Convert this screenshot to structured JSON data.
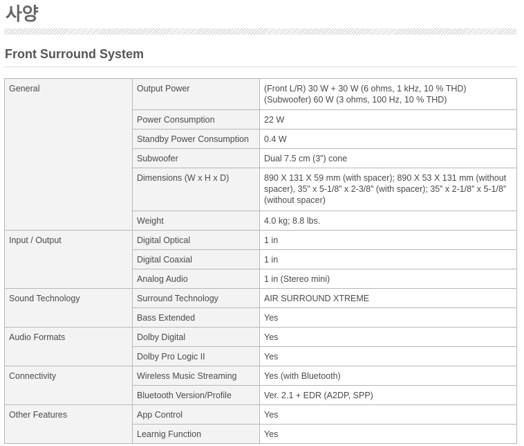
{
  "page": {
    "title": "사양",
    "section_title": "Front Surround System"
  },
  "groups": [
    {
      "name": "General",
      "rows": [
        {
          "label": "Output Power",
          "value": [
            "(Front L/R) 30 W + 30 W (6 ohms, 1 kHz, 10 % THD)",
            "(Subwoofer) 60 W (3 ohms, 100 Hz, 10 % THD)"
          ]
        },
        {
          "label": "Power Consumption",
          "value": [
            "22 W"
          ]
        },
        {
          "label": "Standby Power Consumption",
          "value": [
            "0.4 W"
          ]
        },
        {
          "label": "Subwoofer",
          "value": [
            "Dual 7.5 cm (3”) cone"
          ]
        },
        {
          "label": "Dimensions (W x H x D)",
          "value": [
            "890 X 131 X 59 mm (with spacer); 890 X 53 X 131 mm (without spacer), 35” x 5-1/8” x 2-3/8” (with spacer); 35” x 2-1/8” x 5-1/8” (without spacer)"
          ]
        },
        {
          "label": "Weight",
          "value": [
            "4.0 kg; 8.8 lbs."
          ]
        }
      ]
    },
    {
      "name": "Input / Output",
      "rows": [
        {
          "label": "Digital Optical",
          "value": [
            "1 in"
          ]
        },
        {
          "label": "Digital Coaxial",
          "value": [
            "1 in"
          ]
        },
        {
          "label": "Analog Audio",
          "value": [
            "1 in (Stereo mini)"
          ]
        }
      ]
    },
    {
      "name": "Sound Technology",
      "rows": [
        {
          "label": "Surround Technology",
          "value": [
            "AIR SURROUND XTREME"
          ]
        },
        {
          "label": "Bass Extended",
          "value": [
            "Yes"
          ]
        }
      ]
    },
    {
      "name": "Audio Formats",
      "rows": [
        {
          "label": "Dolby Digital",
          "value": [
            "Yes"
          ]
        },
        {
          "label": "Dolby Pro Logic II",
          "value": [
            "Yes"
          ]
        }
      ]
    },
    {
      "name": "Connectivity",
      "rows": [
        {
          "label": "Wireless Music Streaming",
          "value": [
            "Yes (with Bluetooth)"
          ]
        },
        {
          "label": "Bluetooth Version/Profile",
          "value": [
            "Ver. 2.1 + EDR (A2DP, SPP)"
          ]
        }
      ]
    },
    {
      "name": "Other Features",
      "rows": [
        {
          "label": "App Control",
          "value": [
            "Yes"
          ]
        },
        {
          "label": "Learnig Function",
          "value": [
            "Yes"
          ]
        }
      ]
    }
  ]
}
